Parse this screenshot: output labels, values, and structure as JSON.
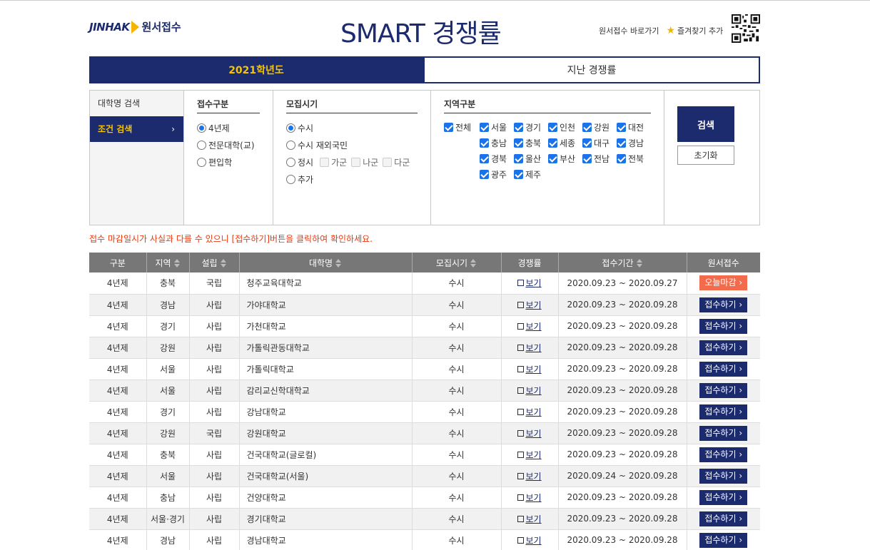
{
  "header": {
    "logo_brand": "JINHAK",
    "logo_service": "원서접수",
    "title": "SMART 경쟁률",
    "link_apply": "원서접수 바로가기",
    "link_bookmark": "즐겨찾기 추가"
  },
  "tabs": [
    {
      "label": "2021학년도",
      "active": true
    },
    {
      "label": "지난 경쟁률",
      "active": false
    }
  ],
  "sidebar": {
    "items": [
      {
        "label": "대학명 검색",
        "active": false
      },
      {
        "label": "조건 검색",
        "active": true
      }
    ]
  },
  "filters": {
    "type": {
      "title": "접수구분",
      "options": [
        {
          "label": "4년제",
          "checked": true
        },
        {
          "label": "전문대학(교)",
          "checked": false
        },
        {
          "label": "편입학",
          "checked": false
        }
      ]
    },
    "period": {
      "title": "모집시기",
      "options": [
        "수시",
        "수시 재외국민",
        "정시",
        "추가"
      ],
      "selected": "수시",
      "sub_options": [
        "가군",
        "나군",
        "다군"
      ]
    },
    "region": {
      "title": "지역구분",
      "all_label": "전체",
      "options": [
        "서울",
        "경기",
        "인천",
        "강원",
        "대전",
        "충남",
        "충북",
        "세종",
        "대구",
        "경남",
        "경북",
        "울산",
        "부산",
        "전남",
        "전북",
        "광주",
        "제주"
      ]
    },
    "search_button": "검색",
    "reset_button": "초기화"
  },
  "notice": "접수 마감일시가 사실과 다를 수 있으니 [접수하기]버튼을 클릭하여 확인하세요.",
  "table": {
    "headers": [
      "구분",
      "지역",
      "설립",
      "대학명",
      "모집시기",
      "경쟁률",
      "접수기간",
      "원서접수"
    ],
    "view_label": "보기",
    "rows": [
      {
        "type": "4년제",
        "region": "충북",
        "est": "국립",
        "name": "청주교육대학교",
        "period": "수시",
        "dates": "2020.09.23 ~ 2020.09.27",
        "action": "오늘마감"
      },
      {
        "type": "4년제",
        "region": "경남",
        "est": "사립",
        "name": "가야대학교",
        "period": "수시",
        "dates": "2020.09.23 ~ 2020.09.28",
        "action": "접수하기"
      },
      {
        "type": "4년제",
        "region": "경기",
        "est": "사립",
        "name": "가천대학교",
        "period": "수시",
        "dates": "2020.09.23 ~ 2020.09.28",
        "action": "접수하기"
      },
      {
        "type": "4년제",
        "region": "강원",
        "est": "사립",
        "name": "가톨릭관동대학교",
        "period": "수시",
        "dates": "2020.09.23 ~ 2020.09.28",
        "action": "접수하기"
      },
      {
        "type": "4년제",
        "region": "서울",
        "est": "사립",
        "name": "가톨릭대학교",
        "period": "수시",
        "dates": "2020.09.23 ~ 2020.09.28",
        "action": "접수하기"
      },
      {
        "type": "4년제",
        "region": "서울",
        "est": "사립",
        "name": "감리교신학대학교",
        "period": "수시",
        "dates": "2020.09.23 ~ 2020.09.28",
        "action": "접수하기"
      },
      {
        "type": "4년제",
        "region": "경기",
        "est": "사립",
        "name": "강남대학교",
        "period": "수시",
        "dates": "2020.09.23 ~ 2020.09.28",
        "action": "접수하기"
      },
      {
        "type": "4년제",
        "region": "강원",
        "est": "국립",
        "name": "강원대학교",
        "period": "수시",
        "dates": "2020.09.23 ~ 2020.09.28",
        "action": "접수하기"
      },
      {
        "type": "4년제",
        "region": "충북",
        "est": "사립",
        "name": "건국대학교(글로컬)",
        "period": "수시",
        "dates": "2020.09.23 ~ 2020.09.28",
        "action": "접수하기"
      },
      {
        "type": "4년제",
        "region": "서울",
        "est": "사립",
        "name": "건국대학교(서울)",
        "period": "수시",
        "dates": "2020.09.24 ~ 2020.09.28",
        "action": "접수하기"
      },
      {
        "type": "4년제",
        "region": "충남",
        "est": "사립",
        "name": "건양대학교",
        "period": "수시",
        "dates": "2020.09.23 ~ 2020.09.28",
        "action": "접수하기"
      },
      {
        "type": "4년제",
        "region": "서울·경기",
        "est": "사립",
        "name": "경기대학교",
        "period": "수시",
        "dates": "2020.09.23 ~ 2020.09.28",
        "action": "접수하기"
      },
      {
        "type": "4년제",
        "region": "경남",
        "est": "사립",
        "name": "경남대학교",
        "period": "수시",
        "dates": "2020.09.23 ~ 2020.09.28",
        "action": "접수하기"
      }
    ]
  },
  "colors": {
    "navy": "#1c2a6e",
    "gold": "#f4c400",
    "today": "#f26b4d",
    "notice": "#e8390e"
  }
}
